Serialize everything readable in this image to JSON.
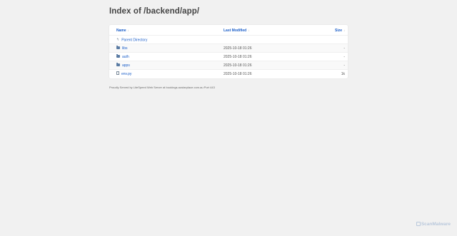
{
  "title": "Index of /backend/app/",
  "table": {
    "headers": {
      "name": "Name",
      "modified": "Last Modified",
      "size": "Size"
    },
    "sort_arrow": "↓",
    "rows": [
      {
        "name": "Parent Directory",
        "type": "parent",
        "modified": "",
        "size": ""
      },
      {
        "name": "libs",
        "type": "folder",
        "modified": "2025-10-18 01:26",
        "size": "-"
      },
      {
        "name": "auth",
        "type": "folder",
        "modified": "2025-10-18 01:26",
        "size": "-"
      },
      {
        "name": "apps",
        "type": "folder",
        "modified": "2025-10-18 01:26",
        "size": "-"
      },
      {
        "name": "env.py",
        "type": "file",
        "modified": "2025-10-18 01:26",
        "size": "1k"
      }
    ]
  },
  "footer": "Proudly Served by LiteSpeed Web Server at bookings.austarplace.com.au Port 443",
  "watermark": "ScanMalware",
  "icons": {
    "parent": "arrow-up-icon",
    "folder": "folder-icon",
    "file": "file-icon"
  },
  "colors": {
    "link": "#1a5ec9",
    "background": "#f1f1f1"
  }
}
